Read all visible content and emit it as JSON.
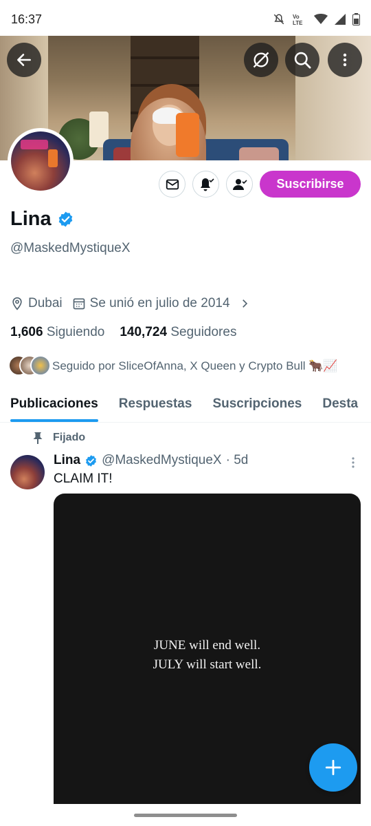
{
  "status_bar": {
    "time": "16:37",
    "icons": [
      "mute-bell-icon",
      "volte-icon",
      "wifi-icon",
      "signal-icon",
      "battery-icon"
    ]
  },
  "header": {
    "icons": [
      "back-arrow-icon",
      "hide-icon",
      "search-icon",
      "more-vert-icon"
    ]
  },
  "profile": {
    "name": "Lina",
    "verified": true,
    "handle": "@MaskedMystiqueX",
    "location": "Dubai",
    "joined": "Se unió en julio de 2014",
    "following_count": "1,606",
    "following_label": "Siguiendo",
    "followers_count": "140,724",
    "followers_label": "Seguidores",
    "followed_by": "Seguido por SliceOfAnna, X Queen y Crypto Bull 🐂📈",
    "subscribe_label": "Suscribirse"
  },
  "tabs": [
    {
      "label": "Publicaciones",
      "active": true
    },
    {
      "label": "Respuestas",
      "active": false
    },
    {
      "label": "Suscripciones",
      "active": false
    },
    {
      "label": "Desta",
      "active": false
    }
  ],
  "post": {
    "pinned_label": "Fijado",
    "author": "Lina",
    "handle": "@MaskedMystiqueX",
    "time": "· 5d",
    "text": "CLAIM IT!",
    "image_lines": [
      "JUNE will end well.",
      "JULY will start well."
    ]
  },
  "colors": {
    "accent": "#1d9bf0",
    "subscribe": "#c936cc",
    "secondary_text": "#536471",
    "primary_text": "#0f1419"
  }
}
